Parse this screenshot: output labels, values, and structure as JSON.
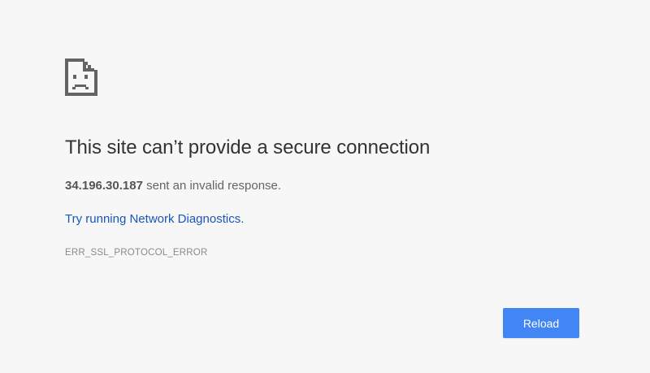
{
  "error_page": {
    "icon": "sad-document-icon",
    "title": "This site can’t provide a secure connection",
    "host": "34.196.30.187",
    "message_suffix": " sent an invalid response.",
    "diagnostics_link": "Try running Network Diagnostics.",
    "error_code": "ERR_SSL_PROTOCOL_ERROR",
    "reload_label": "Reload"
  },
  "colors": {
    "background": "#f7f7f7",
    "title": "#333333",
    "link": "#1a56b5",
    "button": "#4285f4",
    "icon": "#646464"
  }
}
